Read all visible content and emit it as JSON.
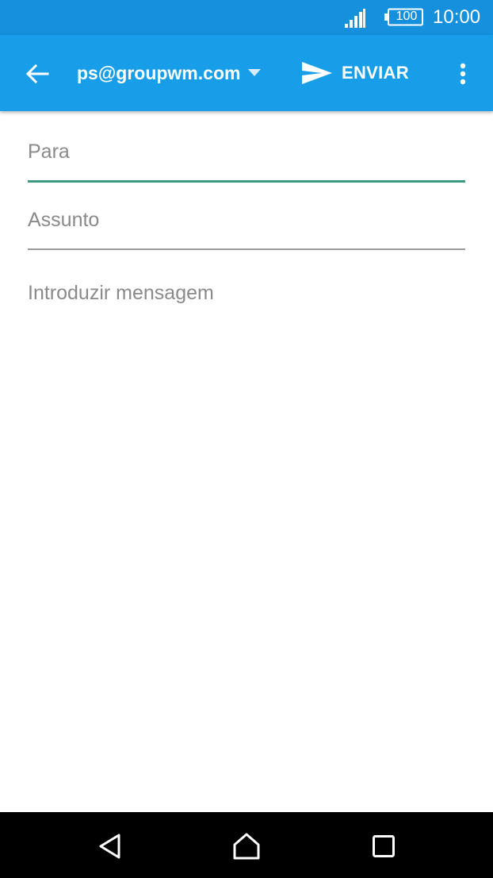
{
  "status_bar": {
    "battery_level": "100",
    "time": "10:00",
    "signal_icon": "signal-icon",
    "battery_icon": "battery-icon"
  },
  "app_bar": {
    "back_icon": "arrow-back-icon",
    "account": "ps@groupwm.com",
    "dropdown_icon": "dropdown-triangle-icon",
    "send_icon": "send-icon",
    "send_label": "ENVIAR",
    "overflow_icon": "more-vert-icon"
  },
  "compose": {
    "to_placeholder": "Para",
    "to_value": "",
    "subject_placeholder": "Assunto",
    "subject_value": "",
    "body_placeholder": "Introduzir mensagem",
    "body_value": ""
  },
  "nav_bar": {
    "back_icon": "nav-back-icon",
    "home_icon": "nav-home-icon",
    "recents_icon": "nav-recents-icon"
  },
  "colors": {
    "status_bar": "#1490dc",
    "app_bar": "#189ee8",
    "active_underline": "#3b9a7e",
    "inactive_underline": "#9a9a9a",
    "nav_bar": "#000000"
  }
}
